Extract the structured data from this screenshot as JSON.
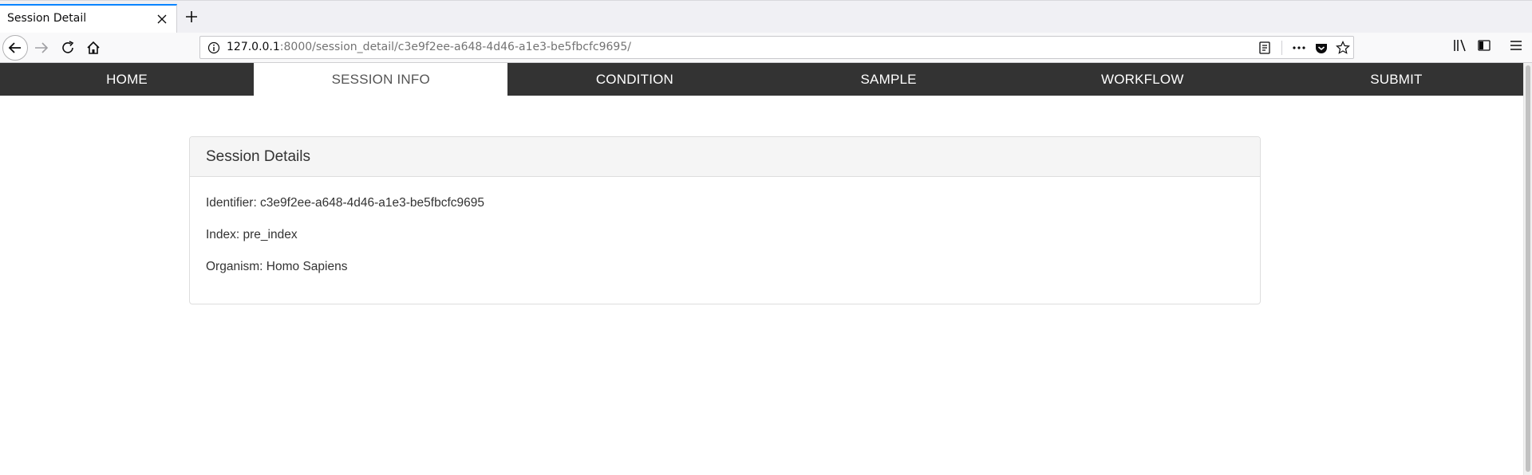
{
  "browser": {
    "tab_title": "Session Detail",
    "url_host": "127.0.0.1",
    "url_rest": ":8000/session_detail/c3e9f2ee-a648-4d46-a1e3-be5fbcfc9695/"
  },
  "nav": {
    "items": [
      "HOME",
      "SESSION INFO",
      "CONDITION",
      "SAMPLE",
      "WORKFLOW",
      "SUBMIT"
    ],
    "active": "SESSION INFO"
  },
  "panel": {
    "title": "Session Details",
    "identifier": "Identifier: c3e9f2ee-a648-4d46-a1e3-be5fbcfc9695",
    "index": "Index: pre_index",
    "organism": "Organism: Homo Sapiens"
  },
  "colors": {
    "nav_background": "#333333",
    "nav_active_background": "#ffffff",
    "panel_heading_background": "#f5f5f5"
  }
}
